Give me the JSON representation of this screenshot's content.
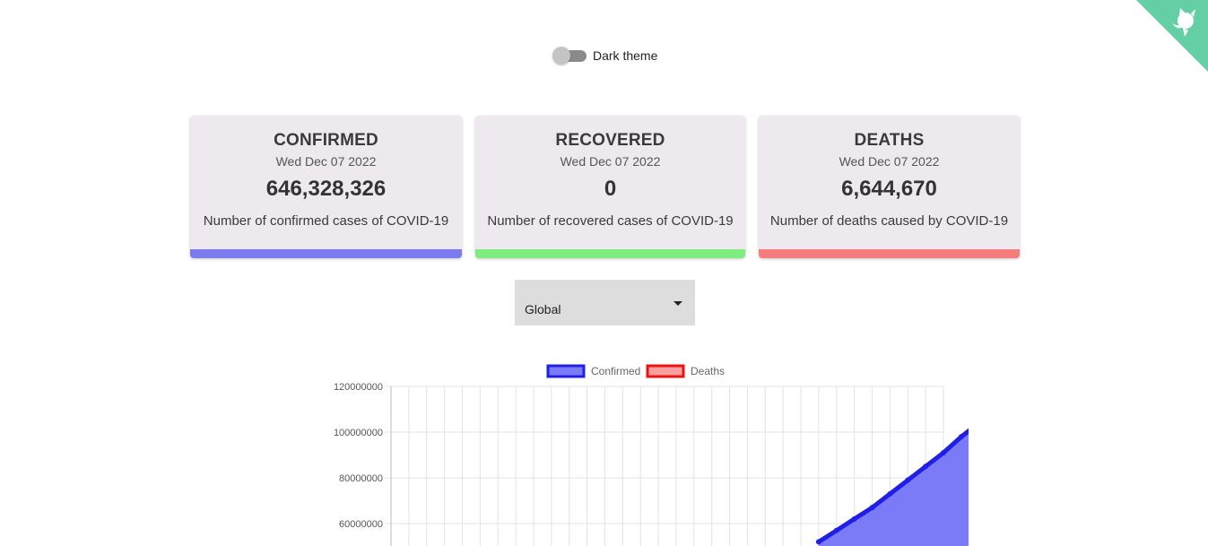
{
  "theme_toggle": {
    "label": "Dark theme",
    "checked": false
  },
  "github_corner": {
    "icon": "github-octocat-icon",
    "color": "#64cea4"
  },
  "cards": [
    {
      "title": "CONFIRMED",
      "date": "Wed Dec 07 2022",
      "value": "646,328,326",
      "description": "Number of confirmed cases of COVID-19",
      "color": "#7b7bf0"
    },
    {
      "title": "RECOVERED",
      "date": "Wed Dec 07 2022",
      "value": "0",
      "description": "Number of recovered cases of COVID-19",
      "color": "#7eec7e"
    },
    {
      "title": "DEATHS",
      "date": "Wed Dec 07 2022",
      "value": "6,644,670",
      "description": "Number of deaths caused by COVID-19",
      "color": "#f47c7c"
    }
  ],
  "region_select": {
    "value": "Global"
  },
  "chart_data": {
    "type": "area",
    "legend": {
      "position": "top",
      "entries": [
        "Confirmed",
        "Deaths"
      ]
    },
    "ylim": [
      50000000,
      120000000
    ],
    "y_ticks": [
      "120000000",
      "100000000",
      "80000000",
      "60000000"
    ],
    "grid": true,
    "x_count": 31,
    "series": [
      {
        "name": "Confirmed",
        "color": "#1f1fe8",
        "fill": "#7b7bf7",
        "points": [
          [
            24,
            52000000
          ],
          [
            25,
            57000000
          ],
          [
            26,
            62000000
          ],
          [
            27,
            67000000
          ],
          [
            28,
            73000000
          ],
          [
            29,
            79000000
          ],
          [
            30,
            85000000
          ],
          [
            31,
            91000000
          ],
          [
            32,
            98000000
          ],
          [
            33,
            104000000
          ]
        ]
      },
      {
        "name": "Deaths",
        "color": "#ee1111",
        "fill": "#f8a0a0",
        "points": []
      }
    ]
  }
}
